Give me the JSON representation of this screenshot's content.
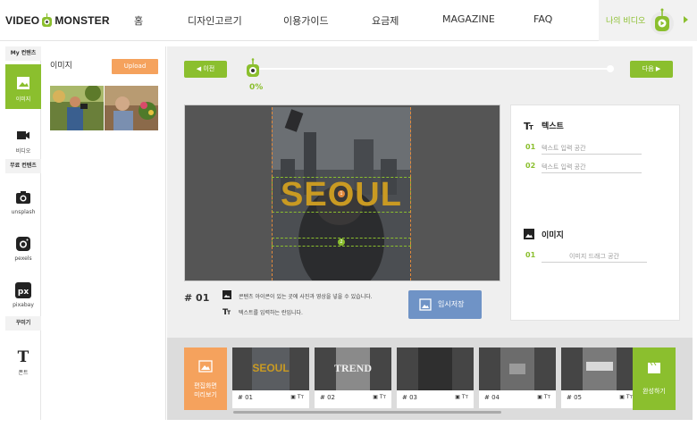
{
  "brand": {
    "name_left": "VIDEO",
    "name_right": "MONSTER",
    "accent": "#8bbf2e",
    "orange": "#f5a25d",
    "blue": "#6f93c6"
  },
  "nav": {
    "items": [
      "홈",
      "디자인고르기",
      "이용가이드",
      "요금제",
      "MAGAZINE",
      "FAQ"
    ],
    "my_video": "나의 비디오"
  },
  "rail": {
    "sections": [
      "My 컨텐츠",
      "무료 컨텐츠",
      "꾸미기"
    ],
    "items": [
      "이미지",
      "비디오",
      "unsplash",
      "pexels",
      "pixabay",
      "폰트"
    ]
  },
  "assets": {
    "title": "이미지",
    "upload": "Upload"
  },
  "editor": {
    "prev": "◀ 이전",
    "next": "다음 ▶",
    "progress": "0%",
    "progress_value": 0,
    "canvas_text": "SEOUL",
    "marker_1": "1",
    "marker_2": "2",
    "slot_number": "# 01",
    "hint_media": "콘텐츠 아이콘이 있는 곳에 사진과 영상을 넣을 수 있습니다.",
    "hint_text": "텍스트를 입력하는 란입니다.",
    "temp_save": "임시저장"
  },
  "side": {
    "text_title": "텍스트",
    "text_fields": [
      {
        "no": "01",
        "placeholder": "텍스트 입력 공간"
      },
      {
        "no": "02",
        "placeholder": "텍스트 입력 공간"
      }
    ],
    "image_title": "이미지",
    "image_fields": [
      {
        "no": "01",
        "placeholder": "이미지 드래그 공간"
      }
    ]
  },
  "strip": {
    "preview": [
      "편집화면",
      "미리보기"
    ],
    "scenes": [
      {
        "label": "# 01",
        "caption": "SEOUL"
      },
      {
        "label": "# 02",
        "caption": "TREND"
      },
      {
        "label": "# 03",
        "caption": ""
      },
      {
        "label": "# 04",
        "caption": ""
      },
      {
        "label": "# 05",
        "caption": ""
      }
    ],
    "scene_icons": "▣ Tт",
    "done": "완성하기"
  }
}
